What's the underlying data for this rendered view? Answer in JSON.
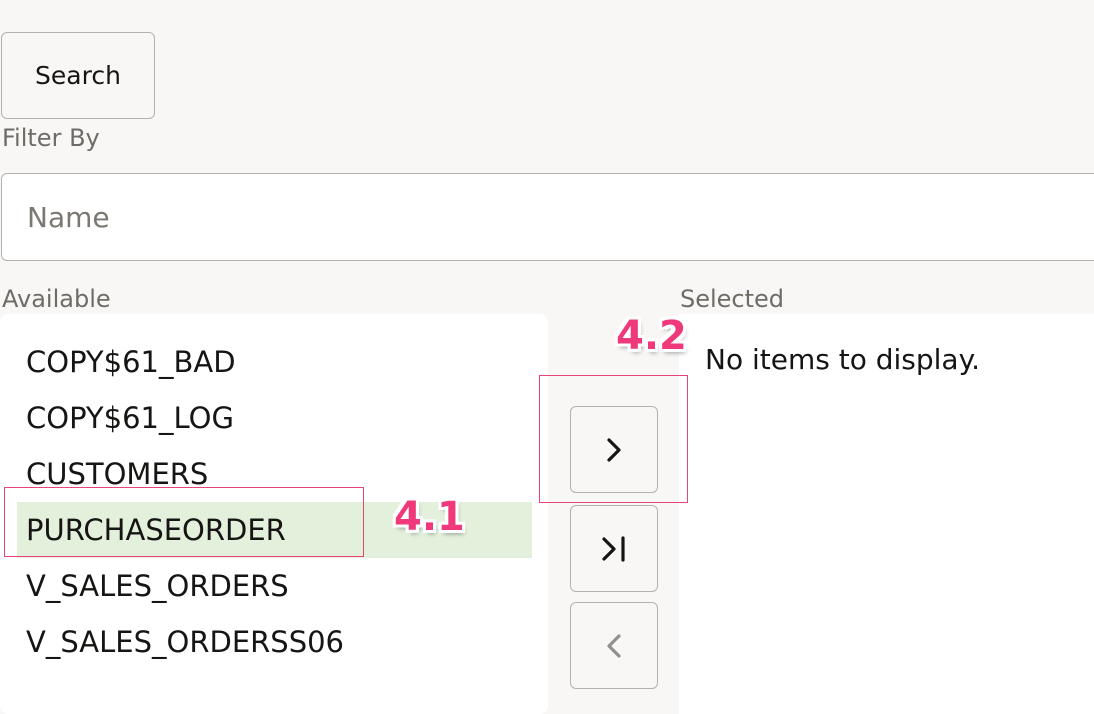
{
  "search_button": {
    "label": "Search"
  },
  "filter": {
    "label": "Filter By",
    "placeholder": "Name"
  },
  "available": {
    "label": "Available",
    "items": [
      {
        "label": "COPY$61_BAD",
        "selected": false
      },
      {
        "label": "COPY$61_LOG",
        "selected": false
      },
      {
        "label": "CUSTOMERS",
        "selected": false
      },
      {
        "label": "PURCHASEORDER",
        "selected": true
      },
      {
        "label": "V_SALES_ORDERS",
        "selected": false
      },
      {
        "label": "V_SALES_ORDERSS06",
        "selected": false
      }
    ]
  },
  "selected": {
    "label": "Selected",
    "empty_message": "No items to display."
  },
  "shuttle_buttons": [
    {
      "name": "move-selected",
      "icon": "chevron-right-icon",
      "enabled": true
    },
    {
      "name": "move-all",
      "icon": "move-all-right-icon",
      "enabled": true
    },
    {
      "name": "remove-selected",
      "icon": "chevron-left-icon",
      "enabled": false
    }
  ],
  "annotations": {
    "step_1": "4.1",
    "step_2": "4.2",
    "color": "#f0397a"
  },
  "colors": {
    "background": "#f8f7f5",
    "panel": "#ffffff",
    "selected_row": "#e3f1dc",
    "border": "#b5b2ad",
    "muted_text": "#6f6c67"
  }
}
